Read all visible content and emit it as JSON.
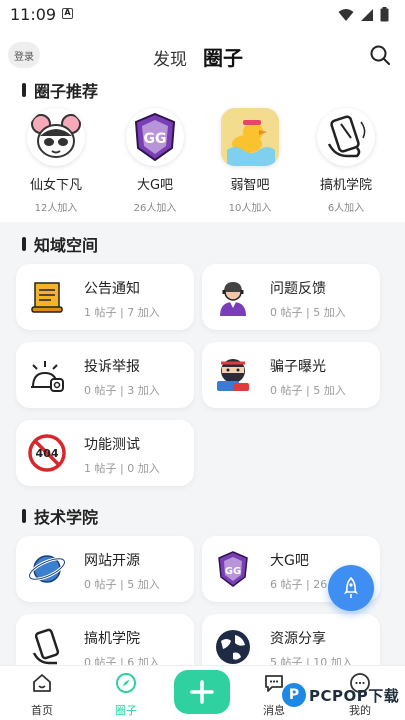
{
  "status_bar": {
    "time": "11:09",
    "indicator": "A"
  },
  "header": {
    "login_label": "登录",
    "tabs": [
      {
        "label": "发现",
        "active": false
      },
      {
        "label": "圈子",
        "active": true
      }
    ],
    "search_icon": "search-icon"
  },
  "recommend": {
    "title": "圈子推荐",
    "items": [
      {
        "name": "仙女下凡",
        "count": "12人加入",
        "icon": "panda-girl-icon"
      },
      {
        "name": "大G吧",
        "count": "26人加入",
        "icon": "gg-shield-icon"
      },
      {
        "name": "弱智吧",
        "count": "10人加入",
        "icon": "duck-bath-icon"
      },
      {
        "name": "搞机学院",
        "count": "6人加入",
        "icon": "phone-hand-icon"
      }
    ]
  },
  "knowledge": {
    "title": "知域空间",
    "cards": [
      {
        "title": "公告通知",
        "meta": "1 帖子 | 7 加入",
        "icon": "scroll-icon"
      },
      {
        "title": "问题反馈",
        "meta": "0 帖子 | 5 加入",
        "icon": "support-agent-icon"
      },
      {
        "title": "投诉举报",
        "meta": "0 帖子 | 3 加入",
        "icon": "report-icon"
      },
      {
        "title": "骗子曝光",
        "meta": "0 帖子 | 5 加入",
        "icon": "ninja-icon"
      },
      {
        "title": "功能测试",
        "meta": "1 帖子 | 0 加入",
        "icon": "no-404-icon"
      }
    ]
  },
  "tech": {
    "title": "技术学院",
    "cards": [
      {
        "title": "网站开源",
        "meta": "0 帖子 | 5 加入",
        "icon": "planet-icon"
      },
      {
        "title": "大G吧",
        "meta": "6 帖子 | 26 加入",
        "icon": "gg-shield-icon"
      },
      {
        "title": "搞机学院",
        "meta": "0 帖子 | 6 加入",
        "icon": "phone-hand-icon"
      },
      {
        "title": "资源分享",
        "meta": "5 帖子 | 10 加入",
        "icon": "globe-icon"
      }
    ]
  },
  "bottom_nav": [
    {
      "label": "首页",
      "icon": "home-icon",
      "active": false
    },
    {
      "label": "圈子",
      "icon": "compass-icon",
      "active": true
    },
    {
      "label": "消息",
      "icon": "message-icon",
      "active": false
    },
    {
      "label": "我的",
      "icon": "profile-icon",
      "active": false
    }
  ],
  "watermark": {
    "badge": "P",
    "text": "PCPOP下载"
  },
  "colors": {
    "accent": "#2fd1a0",
    "fab": "#3f8ef2",
    "background": "#f4f5f7"
  }
}
